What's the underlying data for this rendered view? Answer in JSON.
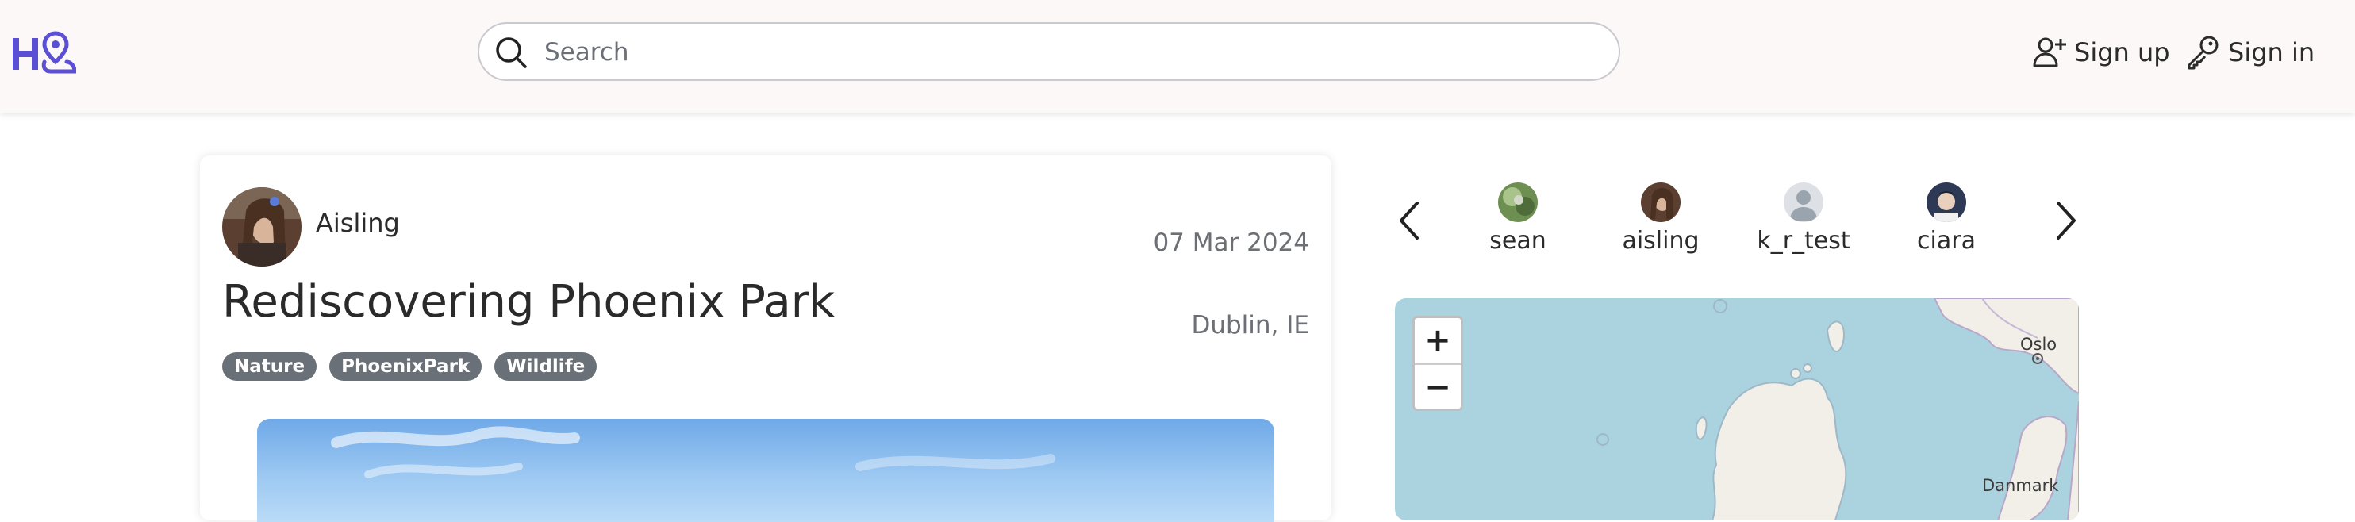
{
  "header": {
    "search_placeholder": "Search",
    "signup_label": "Sign up",
    "signin_label": "Sign in"
  },
  "post": {
    "author": "Aisling",
    "date": "07 Mar 2024",
    "title": "Rediscovering Phoenix Park",
    "location": "Dublin, IE",
    "tags": [
      "Nature",
      "PhoenixPark",
      "Wildlife"
    ]
  },
  "users": [
    {
      "name": "sean"
    },
    {
      "name": "aisling"
    },
    {
      "name": "k_r_test"
    },
    {
      "name": "ciara"
    }
  ],
  "map": {
    "zoom_in": "+",
    "zoom_out": "−",
    "labels": {
      "oslo": "Oslo",
      "danmark": "Danmark"
    }
  },
  "colors": {
    "brand": "#5b4fd6",
    "header_bg": "#fcf8f7",
    "tag_bg": "#6a7077",
    "sea": "#aad3df",
    "land": "#f2efe9"
  },
  "icons": {
    "logo": "logo-icon",
    "search": "search-icon",
    "signup": "user-plus-icon",
    "signin": "key-icon",
    "prev": "chevron-left-icon",
    "next": "chevron-right-icon"
  }
}
